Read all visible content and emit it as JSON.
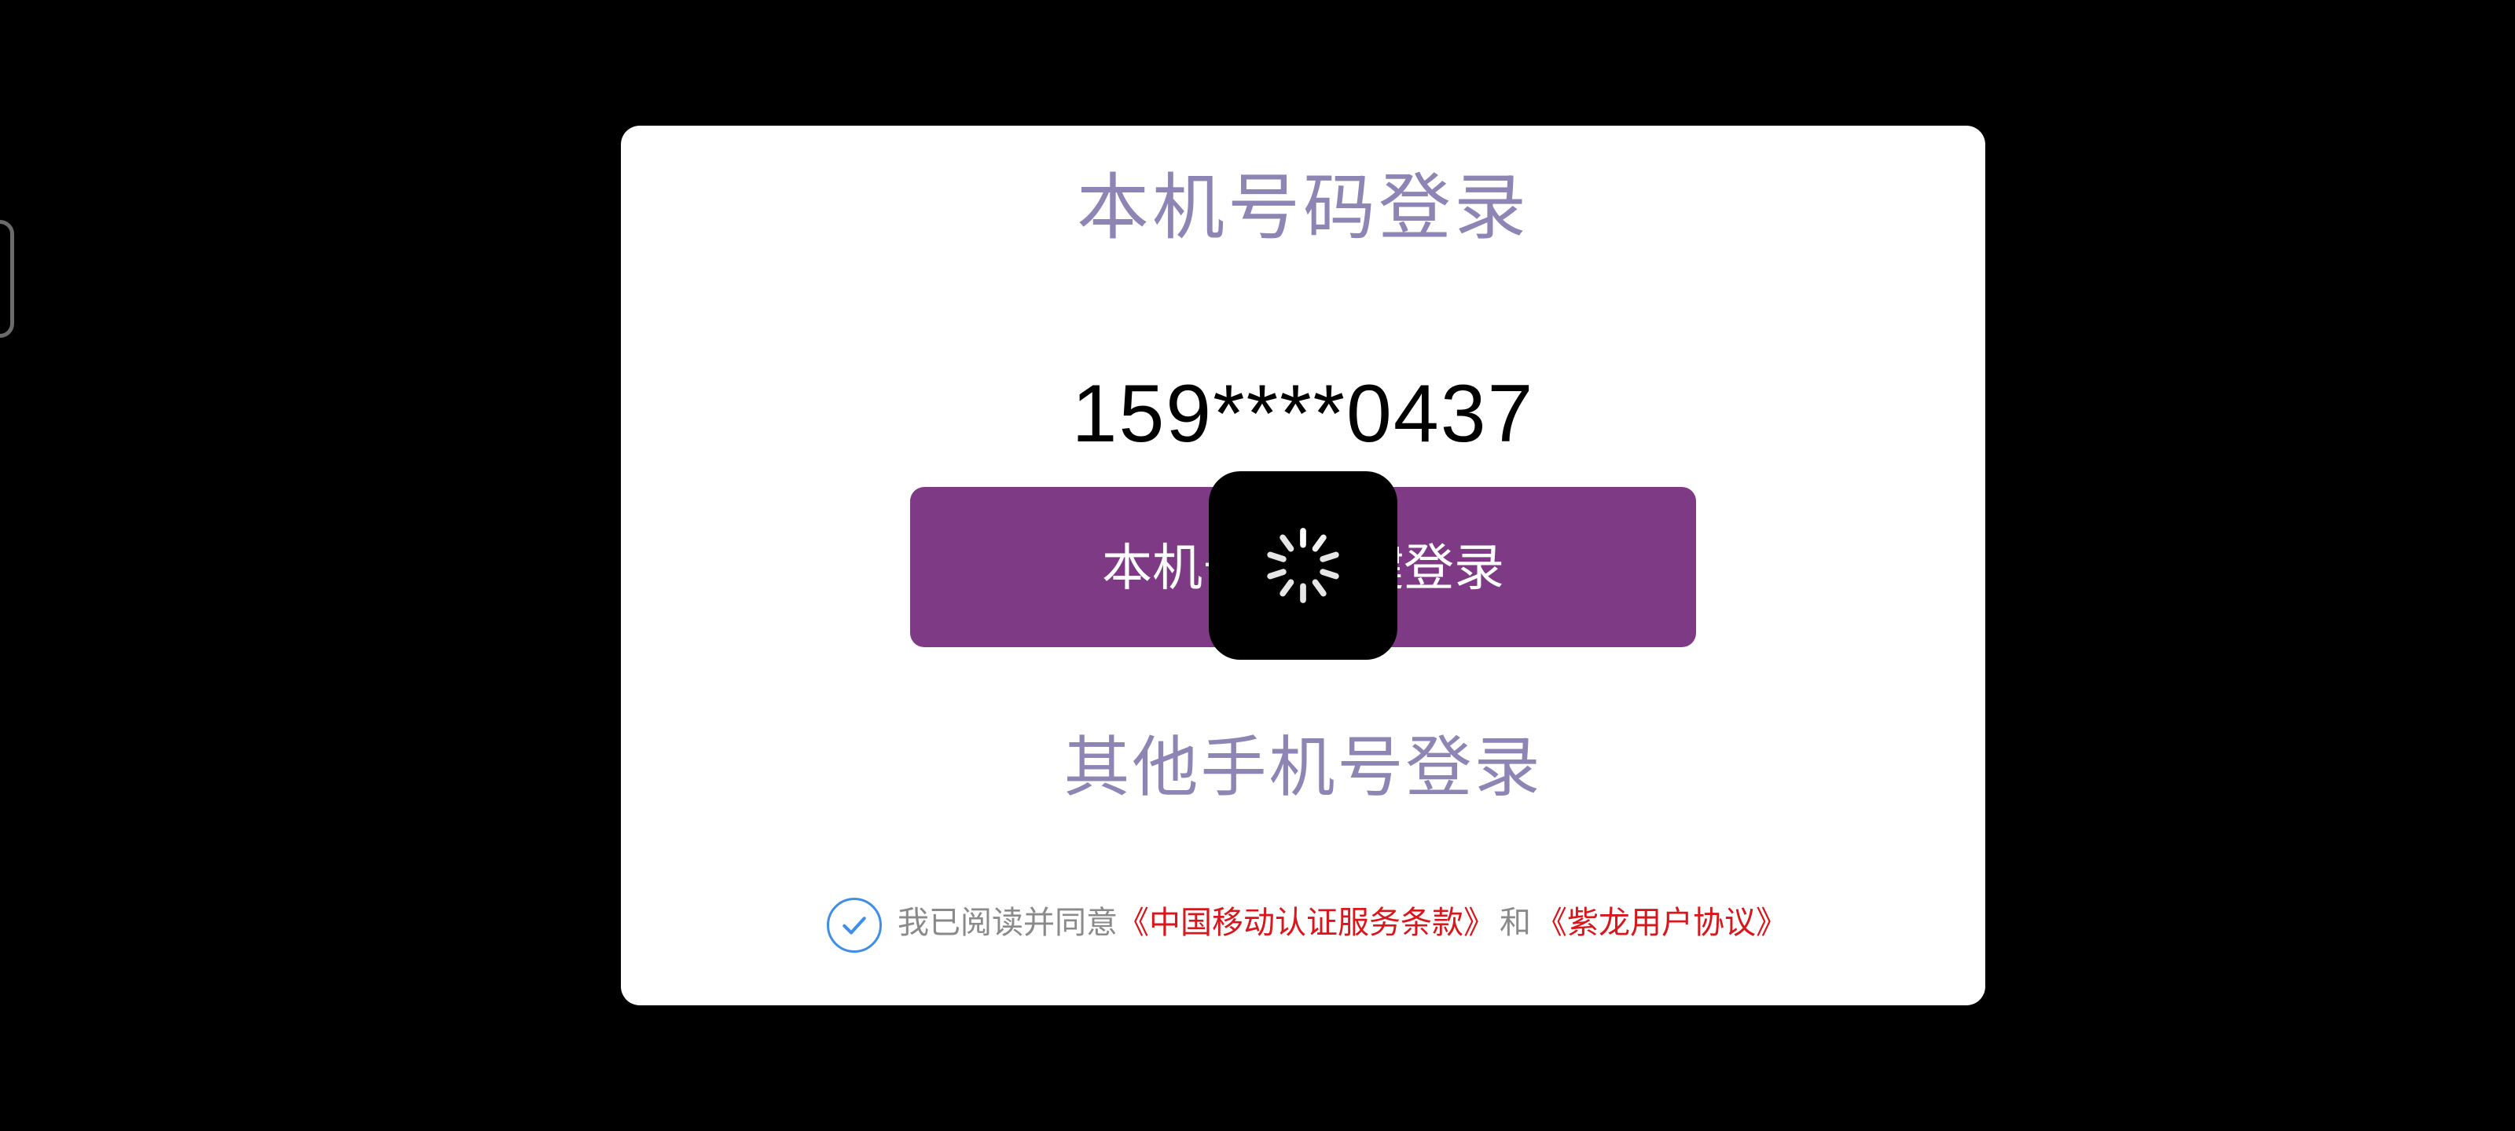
{
  "dialog": {
    "title": "本机号码登录",
    "phone_number": "159****0437",
    "login_button_label": "本机号码一键登录",
    "other_login_label": "其他手机号登录",
    "agreement": {
      "checked": true,
      "prefix": "我已阅读并同意",
      "link1": "《中国移动认证服务条款》",
      "connector": "和",
      "link2": "《紫龙用户协议》"
    }
  },
  "overlay": {
    "type": "loading-spinner",
    "icon": "spinner-icon"
  },
  "colors": {
    "background": "#000000",
    "dialog_background": "#ffffff",
    "title": "#8e85b5",
    "button": "#7f3a86",
    "link": "#d9161b",
    "checkbox": "#3f8ee8"
  }
}
